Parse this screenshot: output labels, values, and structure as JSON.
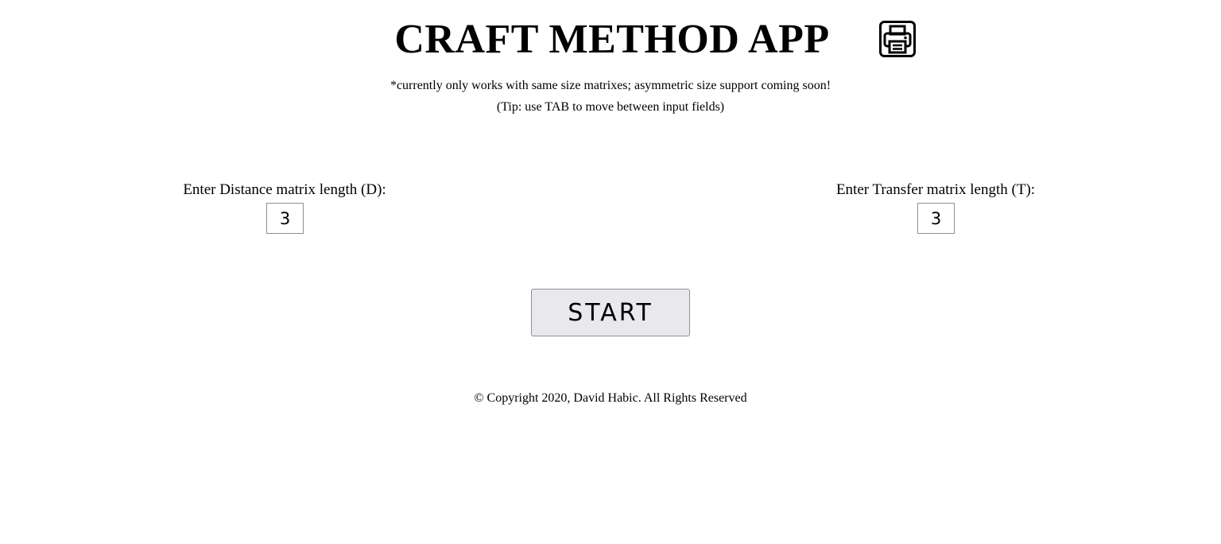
{
  "header": {
    "title": "CRAFT METHOD APP",
    "print_icon": "printer-icon"
  },
  "notes": {
    "line1": "*currently only works with same size matrixes; asymmetric size support coming soon!",
    "line2": "(Tip: use TAB to move between input fields)"
  },
  "distance_field": {
    "label": "Enter Distance matrix length (D):",
    "value": "3"
  },
  "transfer_field": {
    "label": "Enter Transfer matrix length (T):",
    "value": "3"
  },
  "start_button": {
    "label": "START"
  },
  "footer": {
    "copyright": "© Copyright 2020, David Habic. All Rights Reserved"
  }
}
